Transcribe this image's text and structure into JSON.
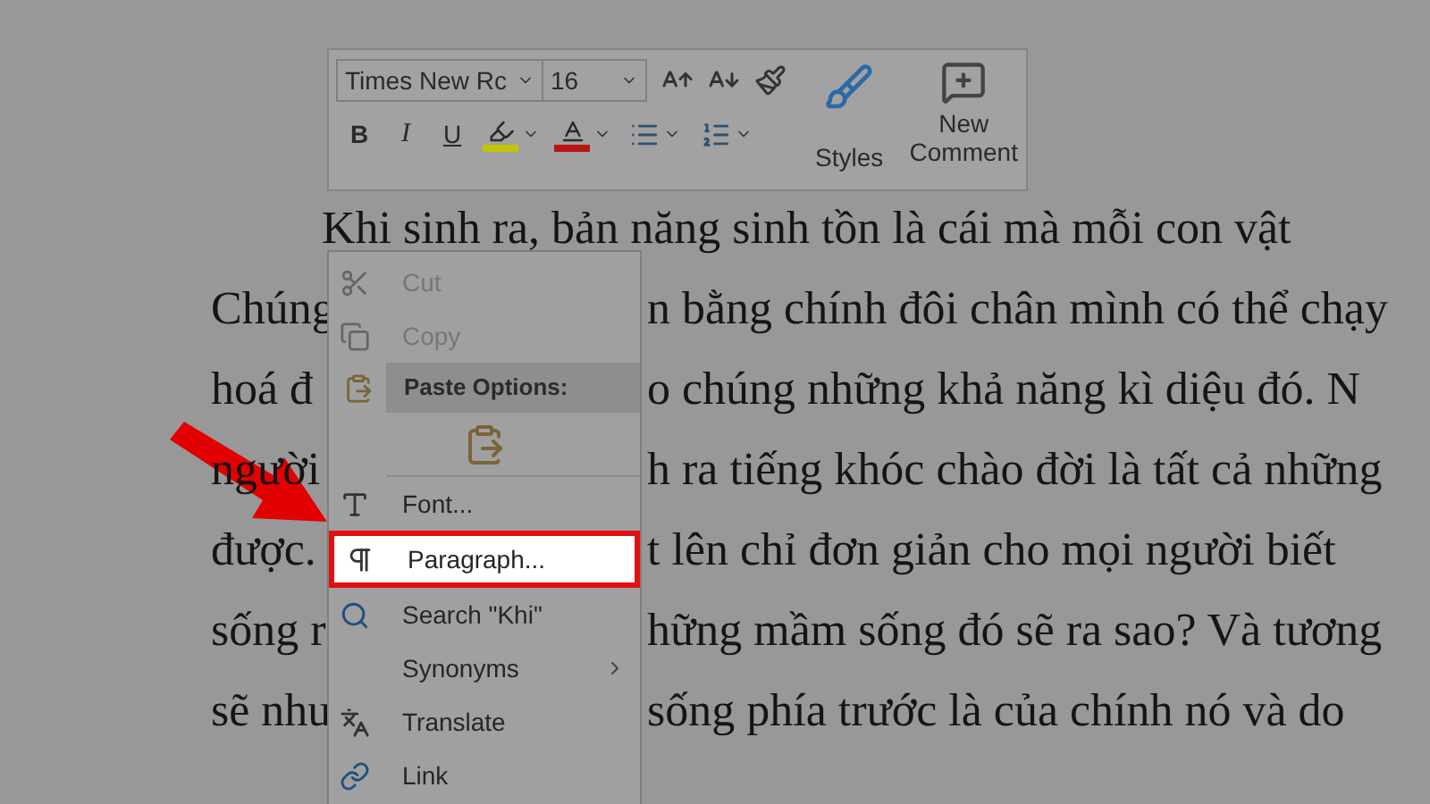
{
  "toolbar": {
    "font_name": "Times New Rc",
    "font_size": "16",
    "row1_tools": [
      {
        "kind": "grow-font"
      },
      {
        "kind": "shrink-font"
      },
      {
        "kind": "format-painter"
      }
    ],
    "row2_tools": [
      {
        "kind": "letter",
        "label": "B"
      },
      {
        "kind": "italic-letter",
        "label": "I"
      },
      {
        "kind": "underline-letter",
        "label": "U"
      },
      {
        "kind": "highlight",
        "color": "#c4c400"
      },
      {
        "kind": "font-color",
        "color": "#b81414"
      },
      {
        "kind": "bullets"
      },
      {
        "kind": "numbering"
      }
    ],
    "styles_button": {
      "label": "Styles"
    },
    "comment_button": {
      "label": "New Comment"
    }
  },
  "document_lines": [
    {
      "kind": "full",
      "text": "Khi sinh ra, bản năng sinh tồn là cái mà mỗi con vật"
    },
    {
      "kind": "split",
      "left": "Chúng",
      "right": "n bằng chính đôi chân mình có thể chạy"
    },
    {
      "kind": "split",
      "left": "hoá đ",
      "right": "o chúng những khả năng kì diệu đó. N"
    },
    {
      "kind": "split",
      "left": "người",
      "right": "h ra tiếng khóc chào đời là tất cả những"
    },
    {
      "kind": "split",
      "left": "được.",
      "right": "t lên chỉ đơn giản cho mọi người biết"
    },
    {
      "kind": "split",
      "left": "sống r",
      "right": "hững mầm sống đó sẽ ra sao? Và tương"
    },
    {
      "kind": "split",
      "left": "sẽ như",
      "right": "sống phía trước là của chính nó và do"
    }
  ],
  "context_menu": {
    "items": [
      {
        "kind": "cut",
        "label": "Cut",
        "disabled": true,
        "selected": false
      },
      {
        "kind": "copy",
        "label": "Copy",
        "disabled": true,
        "selected": false
      },
      {
        "kind": "paste-header",
        "label": "Paste Options:",
        "selected": false
      },
      {
        "kind": "paste-icons",
        "selected": false
      },
      {
        "kind": "font",
        "label": "Font...",
        "disabled": false,
        "selected": false
      },
      {
        "kind": "paragraph",
        "label": "Paragraph...",
        "disabled": false,
        "selected": true
      },
      {
        "kind": "search",
        "label": "Search \"Khi\"",
        "disabled": false,
        "selected": false
      },
      {
        "kind": "synonyms",
        "label": "Synonyms",
        "disabled": false,
        "selected": false
      },
      {
        "kind": "translate",
        "label": "Translate",
        "disabled": false,
        "selected": false
      },
      {
        "kind": "link",
        "label": "Link",
        "disabled": false,
        "selected": false
      }
    ]
  }
}
